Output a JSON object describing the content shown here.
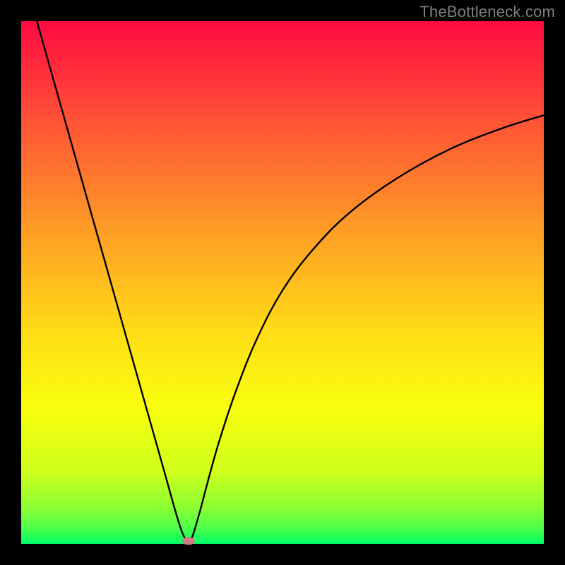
{
  "watermark": {
    "text": "TheBottleneck.com"
  },
  "chart_data": {
    "type": "line",
    "title": "",
    "xlabel": "",
    "ylabel": "",
    "xlim": [
      0,
      100
    ],
    "ylim": [
      0,
      100
    ],
    "grid": false,
    "legend": false,
    "background": {
      "type": "vertical-gradient",
      "stops": [
        {
          "pos": 0.0,
          "color": "#ff0a41"
        },
        {
          "pos": 0.2,
          "color": "#ff5635"
        },
        {
          "pos": 0.4,
          "color": "#fe9d25"
        },
        {
          "pos": 0.6,
          "color": "#fede16"
        },
        {
          "pos": 0.74,
          "color": "#f9ff0d"
        },
        {
          "pos": 0.86,
          "color": "#d0ff1b"
        },
        {
          "pos": 0.93,
          "color": "#8dff33"
        },
        {
          "pos": 0.97,
          "color": "#4dff4a"
        },
        {
          "pos": 1.0,
          "color": "#00ff66"
        }
      ]
    },
    "series": [
      {
        "name": "bottleneck-curve",
        "color": "#000000",
        "x": [
          3,
          6,
          9,
          12,
          15,
          18,
          21,
          24,
          27,
          30,
          31.5,
          32.5,
          34,
          36,
          38,
          41,
          45,
          50,
          56,
          63,
          72,
          82,
          92,
          100
        ],
        "y": [
          100,
          89.4,
          78.8,
          68.2,
          57.6,
          47.0,
          36.4,
          25.8,
          15.2,
          4.6,
          0.8,
          0.8,
          5.5,
          13.0,
          20.0,
          29.0,
          39.0,
          48.5,
          56.5,
          63.5,
          70.0,
          75.5,
          79.5,
          82.0
        ]
      }
    ],
    "annotations": [
      {
        "name": "optimal-point",
        "shape": "ellipse",
        "x": 32,
        "y": 0.5,
        "color": "#cc7d7d"
      }
    ]
  }
}
